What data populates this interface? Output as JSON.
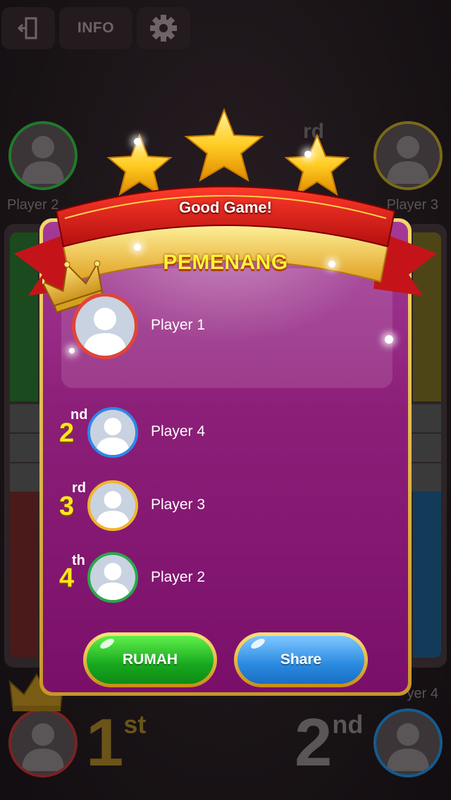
{
  "topbar": {
    "exit_icon": "exit-door-icon",
    "info_label": "INFO",
    "settings_icon": "gear-icon"
  },
  "background": {
    "player2_name": "Player 2",
    "player3_name": "Player 3",
    "player4_name": "yer 4",
    "rank_first": "1",
    "rank_first_suffix": "st",
    "rank_second": "2",
    "rank_second_suffix": "nd",
    "rank_third_suffix": "rd"
  },
  "dialog": {
    "ribbon_title": "Good Game!",
    "heading": "PEMENANG",
    "winner": {
      "name": "Player 1",
      "color": "#e0443a"
    },
    "ranks": [
      {
        "number": "2",
        "suffix": "nd",
        "name": "Player 4",
        "color": "#2f86e8"
      },
      {
        "number": "3",
        "suffix": "rd",
        "name": "Player 3",
        "color": "#f2b52a"
      },
      {
        "number": "4",
        "suffix": "th",
        "name": "Player 2",
        "color": "#2aa84a"
      }
    ],
    "home_button": "RUMAH",
    "share_button": "Share"
  },
  "stars": 3,
  "colors": {
    "green": "#2aa84a",
    "yellow": "#f2b52a",
    "red": "#e0443a",
    "blue": "#2f86e8",
    "gold": "#f5d66a",
    "purple": "#8c1f78"
  }
}
